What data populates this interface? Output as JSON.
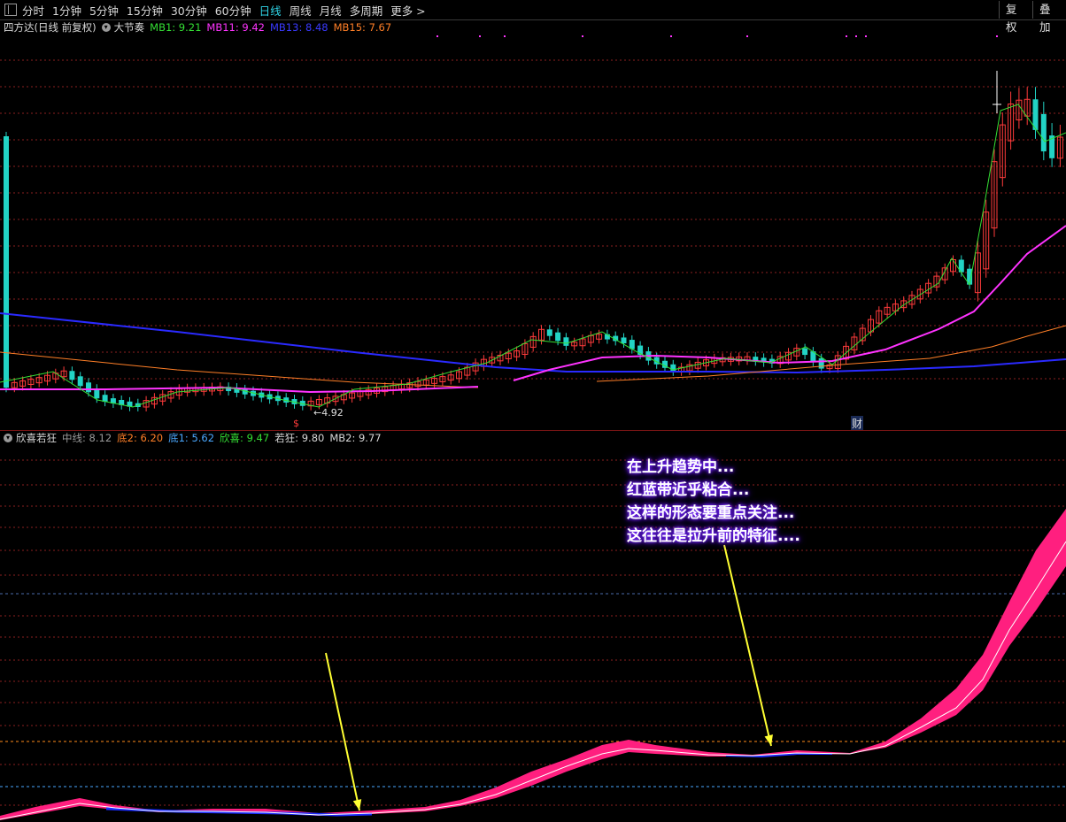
{
  "toolbar": {
    "periods": [
      "分时",
      "1分钟",
      "5分钟",
      "15分钟",
      "30分钟",
      "60分钟",
      "日线",
      "周线",
      "月线",
      "多周期",
      "更多 >"
    ],
    "active_period": "日线",
    "right_buttons": [
      "复权",
      "叠加"
    ]
  },
  "main_legend": {
    "stock": "四方达(日线 前复权)",
    "indicator": "大节奏",
    "mb1": "MB1: 9.21",
    "mb11": "MB11: 9.42",
    "mb13": "MB13: 8.48",
    "mb15": "MB15: 7.67"
  },
  "main_annotations": {
    "low_label": "4.92",
    "s_marker": "$",
    "cai_marker": "财"
  },
  "sub_legend": {
    "indicator": "欣喜若狂",
    "zhongxian": "中线: 8.12",
    "di2": "底2: 6.20",
    "di1": "底1: 5.62",
    "xinxi": "欣喜: 9.47",
    "ruokuang": "若狂: 9.80",
    "mb2": "MB2: 9.77"
  },
  "annotation_text": [
    "在上升趋势中...",
    "红蓝带近乎粘合...",
    "这样的形态要重点关注...",
    "这往往是拉升前的特征...."
  ],
  "colors": {
    "background": "#000000",
    "candle_up": "#ff3b3b",
    "candle_down": "#22d3c5",
    "mb1": "#34e034",
    "mb11": "#ff33ff",
    "mb13": "#2a2aff",
    "mb15": "#ff7f27",
    "band_red": "#ff1f7f",
    "band_blue": "#1a2cff",
    "arrow": "#ffff33",
    "grid": "#8b1f1f"
  }
}
